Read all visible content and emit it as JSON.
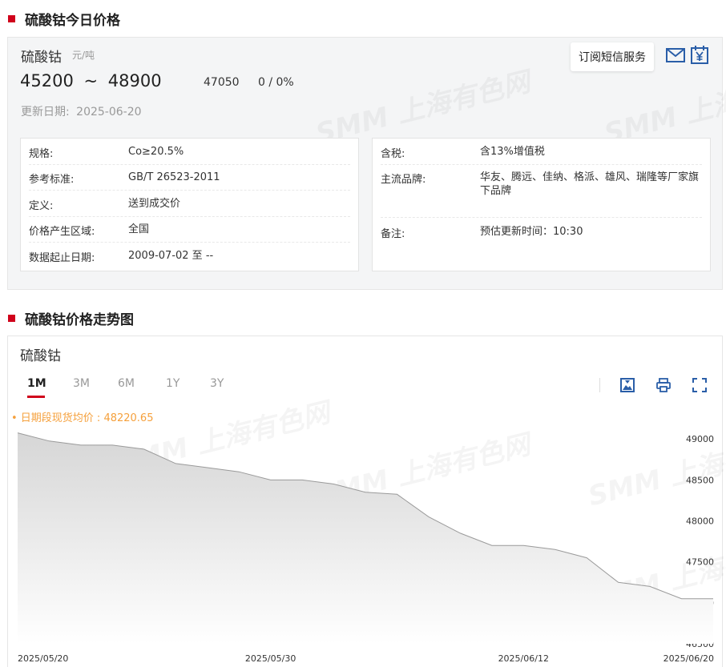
{
  "section1": {
    "title": "硫酸钴今日价格"
  },
  "price": {
    "name": "硫酸钴",
    "unit": "元/吨",
    "low": "45200",
    "tilde": "~",
    "high": "48900",
    "avg": "47050",
    "change": "0 / 0%",
    "update_label": "更新日期:",
    "update_date": "2025-06-20",
    "subscribe_label": "订阅短信服务"
  },
  "info_left": [
    {
      "key": "规格:",
      "value": "Co≥20.5%"
    },
    {
      "key": "参考标准:",
      "value": "GB/T 26523-2011"
    },
    {
      "key": "定义:",
      "value": "送到成交价"
    },
    {
      "key": "价格产生区域:",
      "value": "全国"
    },
    {
      "key": "数据起止日期:",
      "value": "2009-07-02 至 --"
    }
  ],
  "info_right": [
    {
      "key": "含税:",
      "value": "含13%增值税"
    },
    {
      "key": "主流品牌:",
      "value": "华友、腾远、佳纳、格派、雄风、瑞隆等厂家旗下品牌"
    },
    {
      "key": "备注:",
      "value": "预估更新时间：10:30"
    }
  ],
  "section2": {
    "title": "硫酸钴价格走势图"
  },
  "chart_panel": {
    "title": "硫酸钴",
    "tabs": [
      "1M",
      "3M",
      "6M",
      "1Y",
      "3Y"
    ],
    "active_tab": "1M",
    "avg_label": "• 日期段现货均价 : 48220.65"
  },
  "watermark": "SMM 上海有色网",
  "chart_data": {
    "type": "area",
    "x": [
      "2025/05/20",
      "2025/05/21",
      "2025/05/22",
      "2025/05/23",
      "2025/05/26",
      "2025/05/27",
      "2025/05/28",
      "2025/05/29",
      "2025/05/30",
      "2025/06/03",
      "2025/06/04",
      "2025/06/05",
      "2025/06/06",
      "2025/06/09",
      "2025/06/10",
      "2025/06/11",
      "2025/06/12",
      "2025/06/13",
      "2025/06/16",
      "2025/06/17",
      "2025/06/18",
      "2025/06/19",
      "2025/06/20"
    ],
    "series": [
      {
        "values": [
          49075,
          48975,
          48925,
          48925,
          48875,
          48700,
          48650,
          48600,
          48500,
          48500,
          48450,
          48350,
          48325,
          48050,
          47850,
          47700,
          47700,
          47650,
          47550,
          47250,
          47200,
          47050,
          47050
        ]
      }
    ],
    "x_tick_labels": [
      "2025/05/20",
      "2025/05/30",
      "2025/06/12",
      "2025/06/20"
    ],
    "y_ticks": [
      46500,
      47000,
      47500,
      48000,
      48500,
      49000
    ],
    "ylim": [
      46500,
      49100
    ],
    "grid": false,
    "colors": {
      "line": "#9a9a9a",
      "fill_top": "#d6d6d6",
      "fill_bottom": "#ffffff",
      "accent": "#d0021b",
      "avg": "#f5a03c"
    }
  }
}
